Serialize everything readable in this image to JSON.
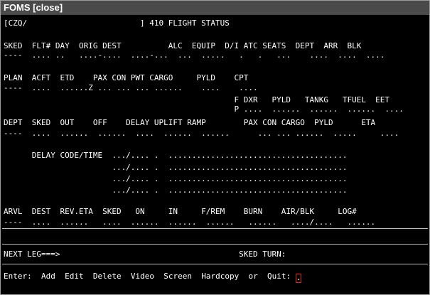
{
  "window": {
    "app_name": "FOMS",
    "close_label": "[close]"
  },
  "screen": {
    "lines": [
      "[CZQ/                        ] 410 FLIGHT STATUS",
      "",
      "SKED  FLT# DAY  ORIG DEST          ALC  EQUIP  D/I ATC SEATS  DEPT  ARR  BLK",
      "----  .... ..   ....-....  ....-...  ...  .....   .   .   ...    ....  ....  ....",
      "",
      "PLAN  ACFT  ETD    PAX CON PWT CARGO     PYLD    CPT",
      "----  ....  ......Z ... ... ... ......    ....    ....",
      "                                                 F DXR   PYLD   TANKG   TFUEL  EET",
      "                                                 P ....  ......  ......  ......  ....",
      "DEPT  SKED  OUT    OFF    DELAY UPLIFT RAMP        PAX CON CARGO  PYLD      ETA",
      "----  ....  ......  ......  ....  ......  ......      ... ... ......  .....     ....",
      "",
      "      DELAY CODE/TIME  .../.... .  ......................................",
      "                       .../.... .  ......................................",
      "                       .../.... .  ......................................",
      "                       .../.... .  ......................................",
      "",
      "ARVL  DEST  REV.ETA  SKED   ON     IN     F/REM    BURN    AIR/BLK     LOG#",
      "----  ....  ......   ....  ......  ......  ......   ......   ..../....   ......",
      "",
      "",
      "NEXT LEG===>                                      SKED TURN:"
    ],
    "command_bar": {
      "prompt": "Enter:",
      "commands": [
        "Add",
        "Edit",
        "Delete",
        "Video",
        "Screen",
        "Hardcopy"
      ],
      "or_text": "or",
      "quit": "Quit:",
      "input_value": "."
    }
  },
  "colors": {
    "background": "#000000",
    "text": "#ffffff",
    "titlebar": "#4a4a4a",
    "cursor_border": "#e0201a"
  }
}
